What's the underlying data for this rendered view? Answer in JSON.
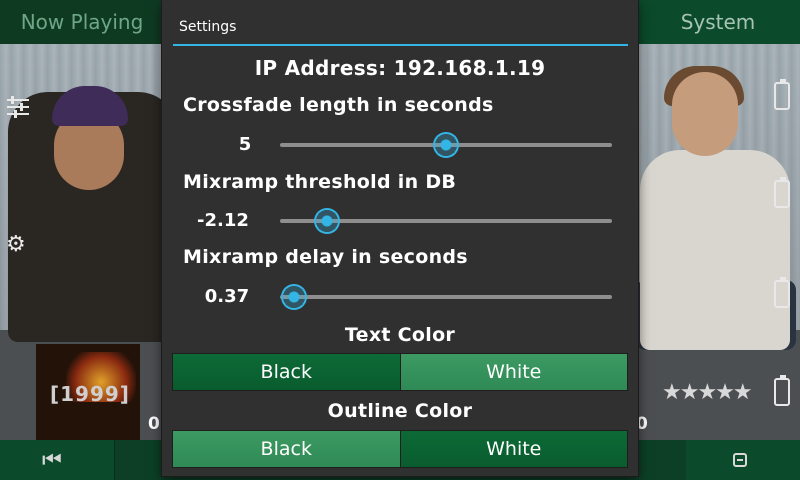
{
  "app": {
    "tabs": {
      "now_playing": "Now Playing",
      "system": "System"
    },
    "album_art_text": "[1999]",
    "time_left": "0",
    "time_right": "0",
    "rating_stars": "★★★★★",
    "icons": [
      "equalizer-icon",
      "gear-icon",
      "battery-icon",
      "previous-track-icon",
      "minus-icon"
    ]
  },
  "settings": {
    "title": "Settings",
    "ip_line": "IP Address: 192.168.1.19",
    "sliders": [
      {
        "label": "Crossfade length in seconds",
        "value_text": "5",
        "value": 5,
        "min": 0,
        "max": 10
      },
      {
        "label": "Mixramp threshold in DB",
        "value_text": "-2.12",
        "value": -2.12,
        "min": -5,
        "max": 20
      },
      {
        "label": "Mixramp delay in seconds",
        "value_text": "0.37",
        "value": 0.37,
        "min": 0,
        "max": 60
      }
    ],
    "text_color": {
      "label": "Text Color",
      "options": [
        "Black",
        "White"
      ],
      "selected": "Black"
    },
    "outline_color": {
      "label": "Outline Color",
      "options": [
        "Black",
        "White"
      ],
      "selected": "White"
    },
    "colors": {
      "accent": "#33b5e5",
      "selected_button": "#0d6a37",
      "unselected_button": "#3c9a62",
      "dialog_bg": "#303030"
    }
  }
}
